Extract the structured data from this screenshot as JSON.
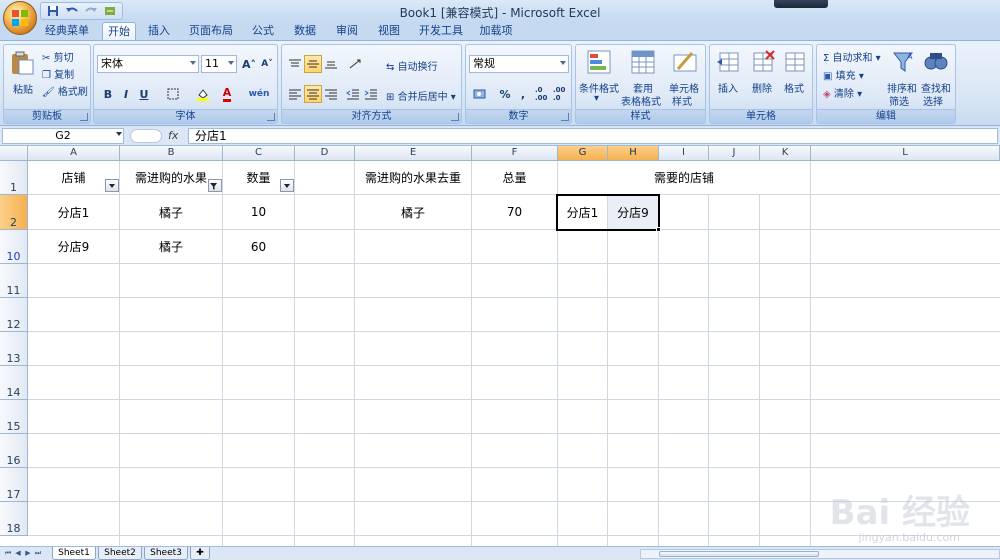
{
  "window": {
    "title": "Book1  [兼容模式] - Microsoft Excel"
  },
  "qat": {
    "items": [
      "save-icon",
      "undo-icon",
      "redo-icon",
      "customize-icon"
    ]
  },
  "ribbon_tabs": [
    "经典菜单",
    "开始",
    "插入",
    "页面布局",
    "公式",
    "数据",
    "审阅",
    "视图",
    "开发工具",
    "加载项"
  ],
  "active_tab": "开始",
  "groups": {
    "clipboard": {
      "label": "剪贴板",
      "paste": "粘贴",
      "cut": "剪切",
      "copy": "复制",
      "format_painter": "格式刷"
    },
    "font": {
      "label": "字体",
      "font_name": "宋体",
      "font_size": "11",
      "bold": "B",
      "italic": "I",
      "underline": "U",
      "grow": "A",
      "shrink": "A",
      "phonetic": "wén"
    },
    "alignment": {
      "label": "对齐方式",
      "wrap": "自动换行",
      "merge": "合并后居中"
    },
    "number": {
      "label": "数字",
      "format": "常规",
      "percent": "%",
      "comma": ",",
      "inc_dec": ".0 .00",
      "dec_dec": ".00 .0"
    },
    "styles": {
      "label": "样式",
      "conditional": [
        "条件格式"
      ],
      "table": [
        "套用",
        "表格格式"
      ],
      "cell_styles": [
        "单元格",
        "样式"
      ]
    },
    "cells": {
      "label": "单元格",
      "insert": "插入",
      "delete": "删除",
      "format": "格式"
    },
    "editing": {
      "label": "编辑",
      "autosum": "Σ 自动求和",
      "fill": "填充",
      "clear": "清除",
      "sort": [
        "排序和",
        "筛选"
      ],
      "find": [
        "查找和",
        "选择"
      ]
    }
  },
  "formula_bar": {
    "name_box": "G2",
    "fx": "fx",
    "value": "分店1"
  },
  "columns": [
    "A",
    "B",
    "C",
    "D",
    "E",
    "F",
    "G",
    "H",
    "I",
    "J",
    "K",
    "L"
  ],
  "rows": [
    "1",
    "2",
    "10",
    "11",
    "12",
    "13",
    "14",
    "15",
    "16",
    "17",
    "18"
  ],
  "cells": {
    "A1": "店铺",
    "B1": "需进购的水果",
    "C1": "数量",
    "E1": "需进购的水果去重",
    "F1": "总量",
    "GL1": "需要的店铺",
    "A2": "分店1",
    "B2": "橘子",
    "C2": "10",
    "E2": "橘子",
    "F2": "70",
    "G2": "分店1",
    "H2": "分店9",
    "A10": "分店9",
    "B10": "橘子",
    "C10": "60"
  },
  "sheets": [
    "Sheet1",
    "Sheet2",
    "Sheet3"
  ],
  "active_sheet": "Sheet1",
  "watermark": {
    "main": "Bai 经验",
    "sub": "jingyan.baidu.com"
  },
  "colors": {
    "accent": "#f5b04f",
    "ribbon": "#dbe7f5",
    "grid_line": "#d0d7e5"
  }
}
